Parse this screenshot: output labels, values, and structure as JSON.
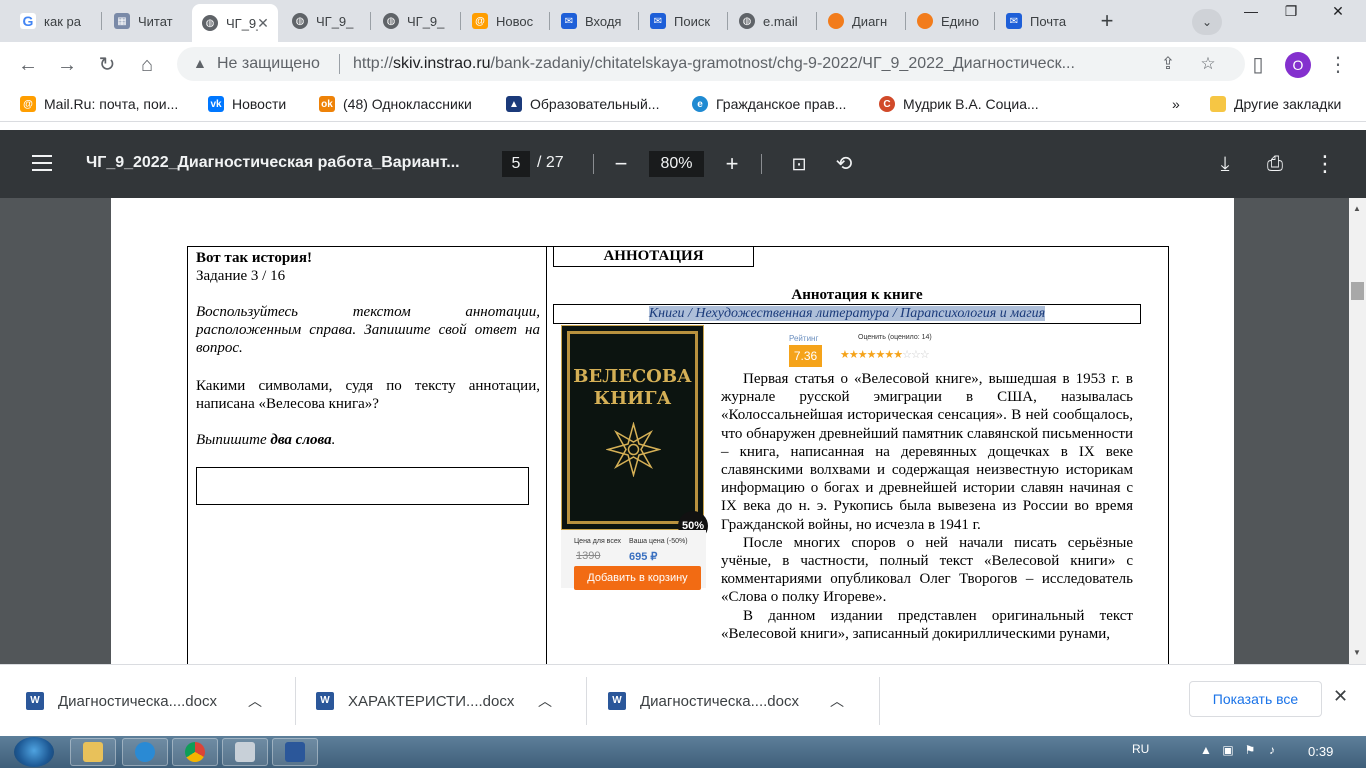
{
  "tabs": [
    {
      "label": "как ра",
      "icon": "google-icon",
      "active": false
    },
    {
      "label": "Читат",
      "icon": "school-icon",
      "active": false
    },
    {
      "label": "ЧГ_9_",
      "icon": "globe-icon",
      "active": true
    },
    {
      "label": "ЧГ_9_",
      "icon": "globe-icon",
      "active": false
    },
    {
      "label": "ЧГ_9_",
      "icon": "globe-icon",
      "active": false
    },
    {
      "label": "Новос",
      "icon": "mailru-icon",
      "active": false
    },
    {
      "label": "Входя",
      "icon": "mail-icon",
      "active": false
    },
    {
      "label": "Поиск",
      "icon": "mail-icon",
      "active": false
    },
    {
      "label": "e.mail",
      "icon": "globe-icon",
      "active": false
    },
    {
      "label": "Диагн",
      "icon": "orange-icon",
      "active": false
    },
    {
      "label": "Едино",
      "icon": "orange-icon",
      "active": false
    },
    {
      "label": "Почта",
      "icon": "mail-icon",
      "active": false
    }
  ],
  "address": {
    "security": "Не защищено",
    "url_host": "skiv.instrao.ru",
    "url_prefix": "http://",
    "url_path": "/bank-zadaniy/chitatelskaya-gramotnost/chg-9-2022/ЧГ_9_2022_Диагностическ...",
    "profile_initial": "O"
  },
  "bookmarks": [
    {
      "label": "Mail.Ru: почта, пои...",
      "icon": "mailru-icon"
    },
    {
      "label": "Новости",
      "icon": "vk-icon"
    },
    {
      "label": "(48) Одноклассники",
      "icon": "ok-icon"
    },
    {
      "label": "Образовательный...",
      "icon": "cdo-icon"
    },
    {
      "label": "Гражданское прав...",
      "icon": "edge-icon"
    },
    {
      "label": "Мудрик В.А. Социа...",
      "icon": "c-icon"
    }
  ],
  "bookmarks_more": "»",
  "bookmarks_other": "Другие закладки",
  "pdf": {
    "title": "ЧГ_9_2022_Диагностическая работа_Вариант...",
    "page": "5",
    "total": "/ 27",
    "zoom": "80%"
  },
  "doc": {
    "left_title": "Вот так история!",
    "task": "Задание 3 / 16",
    "instruction": "Воспользуйтесь текстом аннотации, расположенным справа. Запишите свой ответ на вопрос.",
    "question": "Какими символами, судя по тексту аннотации, написана «Велесова книга»?",
    "write_prefix": "Выпишите ",
    "write_bold": "два слова",
    "write_suffix": ".",
    "tab_label": "АННОТАЦИЯ",
    "anno_heading": "Аннотация к книге",
    "breadcrumb": "Книги / Нехудожественная литература / Парапсихология и магия",
    "cover_title_1": "ВЕЛЕСОВА",
    "cover_title_2": "КНИГА",
    "discount": "50%",
    "price_all_label": "Цена для всех",
    "price_yours_label": "Ваша цена (-50%)",
    "price_old": "1390",
    "price_new": "695 ₽",
    "cart_button": "Добавить в корзину",
    "rating_label": "Рейтинг",
    "rating_value": "7.36",
    "rate_count": "Оценить (оценило: 14)",
    "rating_stars": 7,
    "rating_max": 10,
    "para1": "Первая статья о «Велесовой книге», вышедшая в 1953 г. в журнале русской эмиграции в США, называлась «Колоссальнейшая историческая сенсация». В ней сообщалось, что обнаружен древнейший памятник славянской письменности – книга, написанная на деревянных дощечках в IX веке славянскими волхвами и содержащая неизвестную историкам информацию о богах и древнейшей истории славян начиная с IX века до н. э. Рукопись была вывезена из России во время Гражданской войны, но исчезла в 1941 г.",
    "para2": "После многих споров о ней начали писать серьёзные учёные, в частности, полный текст «Велесовой книги» с комментариями опубликовал Олег Творогов – исследователь «Слова о полку Игореве».",
    "para3": "В данном издании представлен оригинальный текст «Велесовой книги», записанный докириллическими рунами,"
  },
  "downloads": [
    {
      "name": "Диагностическа....docx"
    },
    {
      "name": "ХАРАКТЕРИСТИ....docx"
    },
    {
      "name": "Диагностическа....docx"
    }
  ],
  "show_all": "Показать все",
  "tray": {
    "lang": "RU",
    "time": "0:39"
  },
  "colors": {
    "pdf_toolbar": "#323639",
    "viewer_bg": "#525659",
    "tabstrip": "#dee1e6",
    "accent": "#1a73e8"
  }
}
